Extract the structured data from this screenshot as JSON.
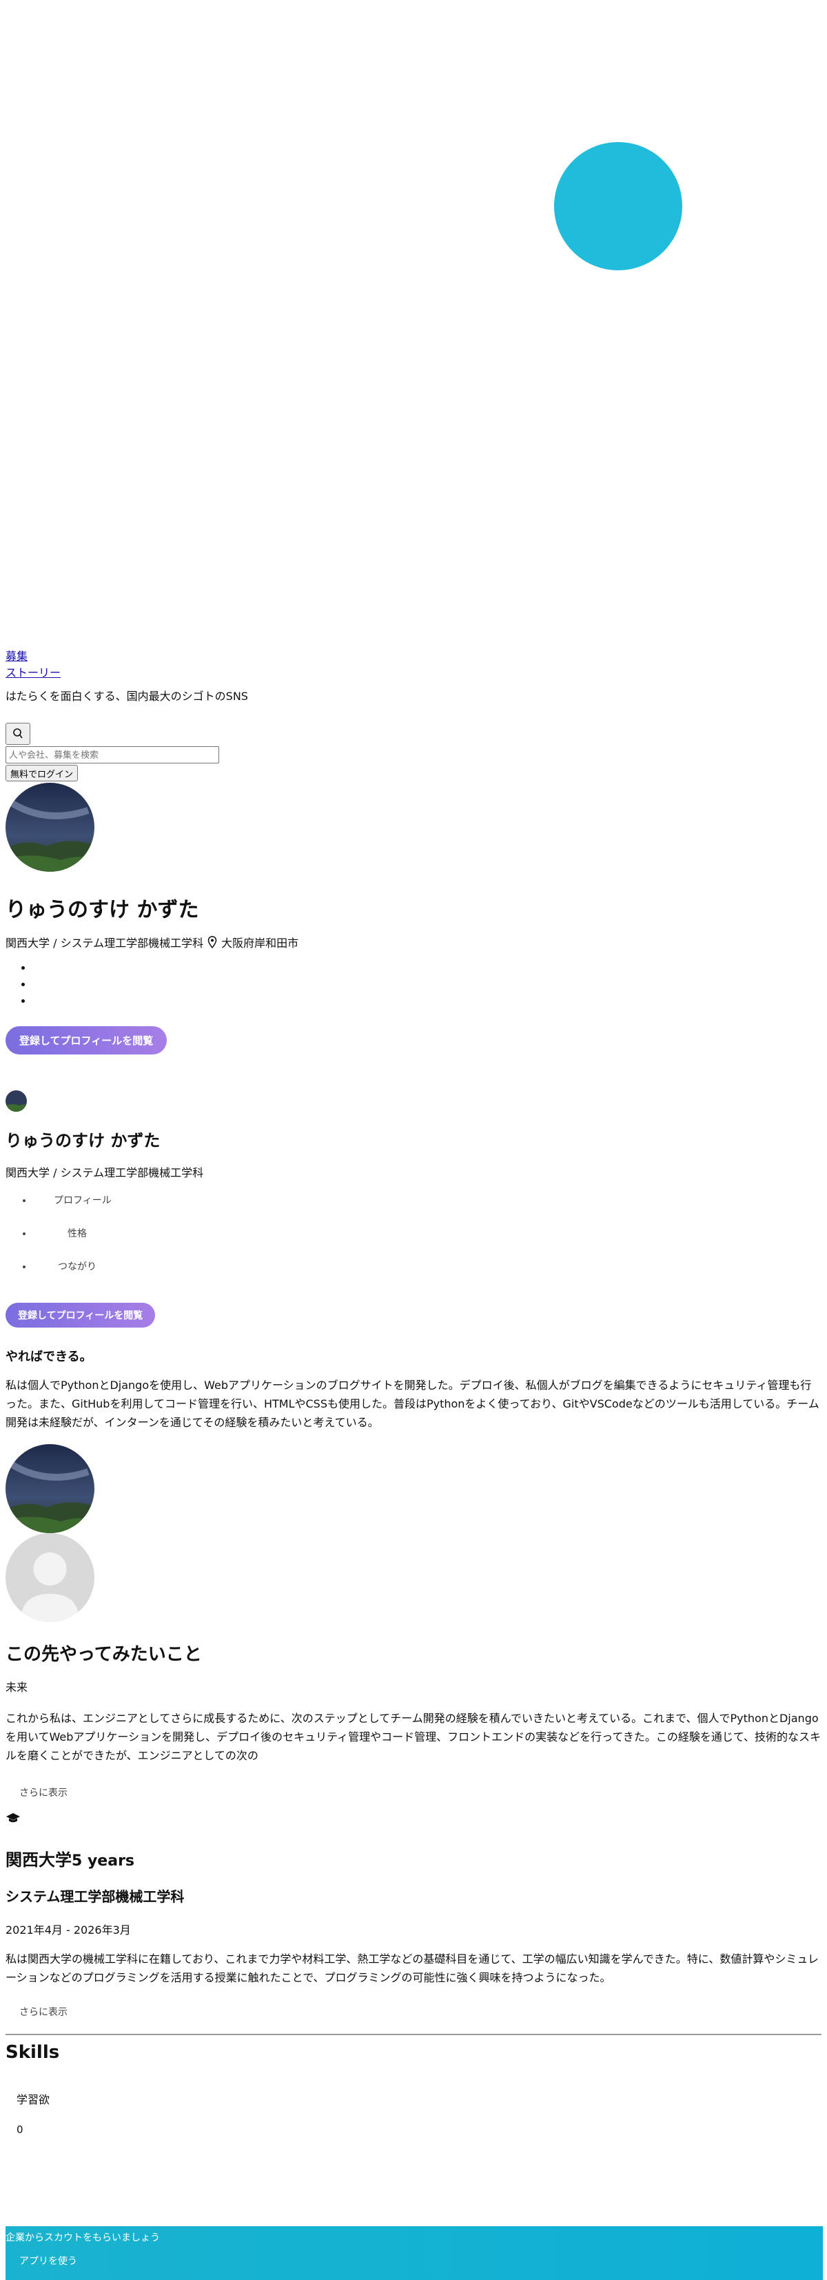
{
  "header": {
    "nav_recruit": "募集",
    "nav_story": "ストーリー",
    "tagline": "はたらくを面白くする、国内最大のシゴトのSNS",
    "search_placeholder": "人や会社、募集を検索",
    "login_label": "無料でログイン"
  },
  "profile": {
    "name": "りゅうのすけ かずた",
    "school": "関西大学 / システム理工学部機械工学科",
    "location": "大阪府岸和田市",
    "cta_label": "登録してプロフィールを閲覧"
  },
  "sticky": {
    "name": "りゅうのすけ かずた",
    "school": "関西大学 / システム理工学部機械工学科",
    "tabs": [
      "プロフィール",
      "性格",
      "つながり"
    ],
    "cta_label": "登録してプロフィールを閲覧"
  },
  "intro": {
    "heading": "やればできる。",
    "body": "私は個人でPythonとDjangoを使用し、Webアプリケーションのブログサイトを開発した。デプロイ後、私個人がブログを編集できるようにセキュリティ管理も行った。また、GitHubを利用してコード管理を行い、HTMLやCSSも使用した。普段はPythonをよく使っており、GitやVSCodeなどのツールも活用している。チーム開発は未経験だが、インターンを通じてその経験を積みたいと考えている。"
  },
  "future": {
    "heading": "この先やってみたいこと",
    "subheading": "未来",
    "body": "これから私は、エンジニアとしてさらに成長するために、次のステップとしてチーム開発の経験を積んでいきたいと考えている。これまで、個人でPythonとDjangoを用いてWebアプリケーションを開発し、デプロイ後のセキュリティ管理やコード管理、フロントエンドの実装などを行ってきた。この経験を通じて、技術的なスキルを磨くことができたが、エンジニアとしての次の",
    "more_label": "さらに表示"
  },
  "education": {
    "school": "関西大学",
    "years": "5 years",
    "department": "システム理工学部機械工学科",
    "period": "2021年4月 - 2026年3月",
    "body": "私は関西大学の機械工学科に在籍しており、これまで力学や材料工学、熱工学などの基礎科目を通じて、工学の幅広い知識を学んできた。特に、数値計算やシミュレーションなどのプログラミングを活用する授業に触れたことで、プログラミングの可能性に強く興味を持つようになった。",
    "more_label": "さらに表示"
  },
  "skills": {
    "heading": "Skills",
    "items": [
      {
        "name": "学習欲",
        "count": "0"
      }
    ]
  },
  "app_banner": {
    "text": "企業からスカウトをもらいましょう",
    "button": "アプリを使う"
  },
  "colors": {
    "accent_circle": "#21bcdc",
    "cta_gradient_start": "#7b6ee0",
    "cta_gradient_end": "#a77ee6",
    "banner": "#14b2d3"
  }
}
